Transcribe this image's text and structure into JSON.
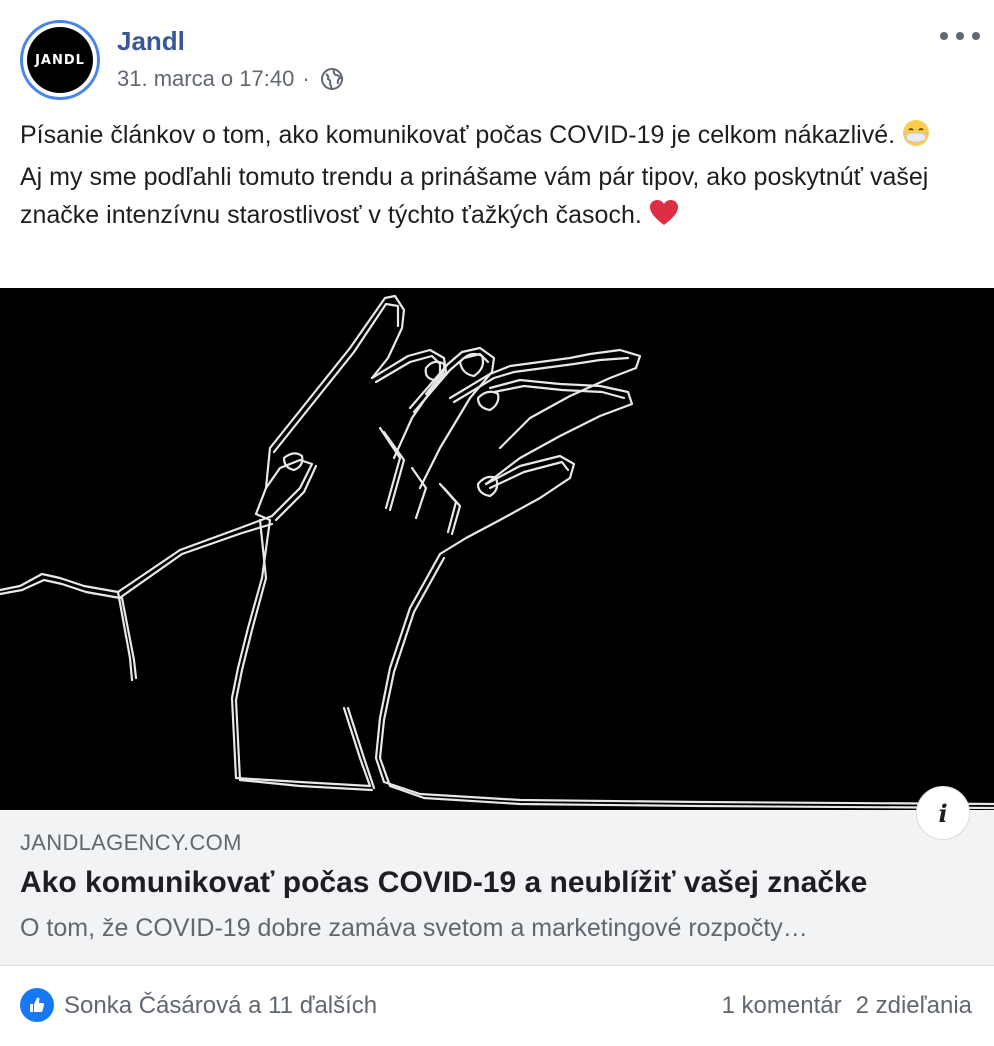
{
  "page": {
    "avatar_text": "JANDL",
    "name": "Jandl",
    "date": "31. marca o 17:40",
    "separator": "·",
    "privacy_icon": "globe-icon",
    "more_icon": "more-horizontal-icon"
  },
  "post": {
    "text_part1": "Písanie článkov o tom, ako komunikovať počas COVID-19 je celkom nákazlivé. ",
    "emoji1": "face-with-medical-mask",
    "text_part2": " Aj my sme podľahli tomuto trendu a prinášame vám pár tipov, ako poskytnúť vašej značke intenzívnu starostlivosť v týchto ťažkých časoch. ",
    "emoji2": "red-heart"
  },
  "link": {
    "domain": "JANDLAGENCY.COM",
    "title": "Ako komunikovať počas COVID-19 a neublížiť vašej značke",
    "description": "O tom, že COVID-19 dobre zamáva svetom a marketingové rozpočty…",
    "info_icon_text": "i"
  },
  "footer": {
    "reaction_icon": "like-icon",
    "reactors": "Sonka Čásárová a 11 ďalších",
    "comments": "1 komentár",
    "shares": "2 zdieľania"
  },
  "colors": {
    "page_name": "#385898",
    "like_blue": "#1877f2",
    "avatar_ring": "#4a86e8",
    "card_bg": "#f2f3f5",
    "secondary_text": "#606770"
  }
}
